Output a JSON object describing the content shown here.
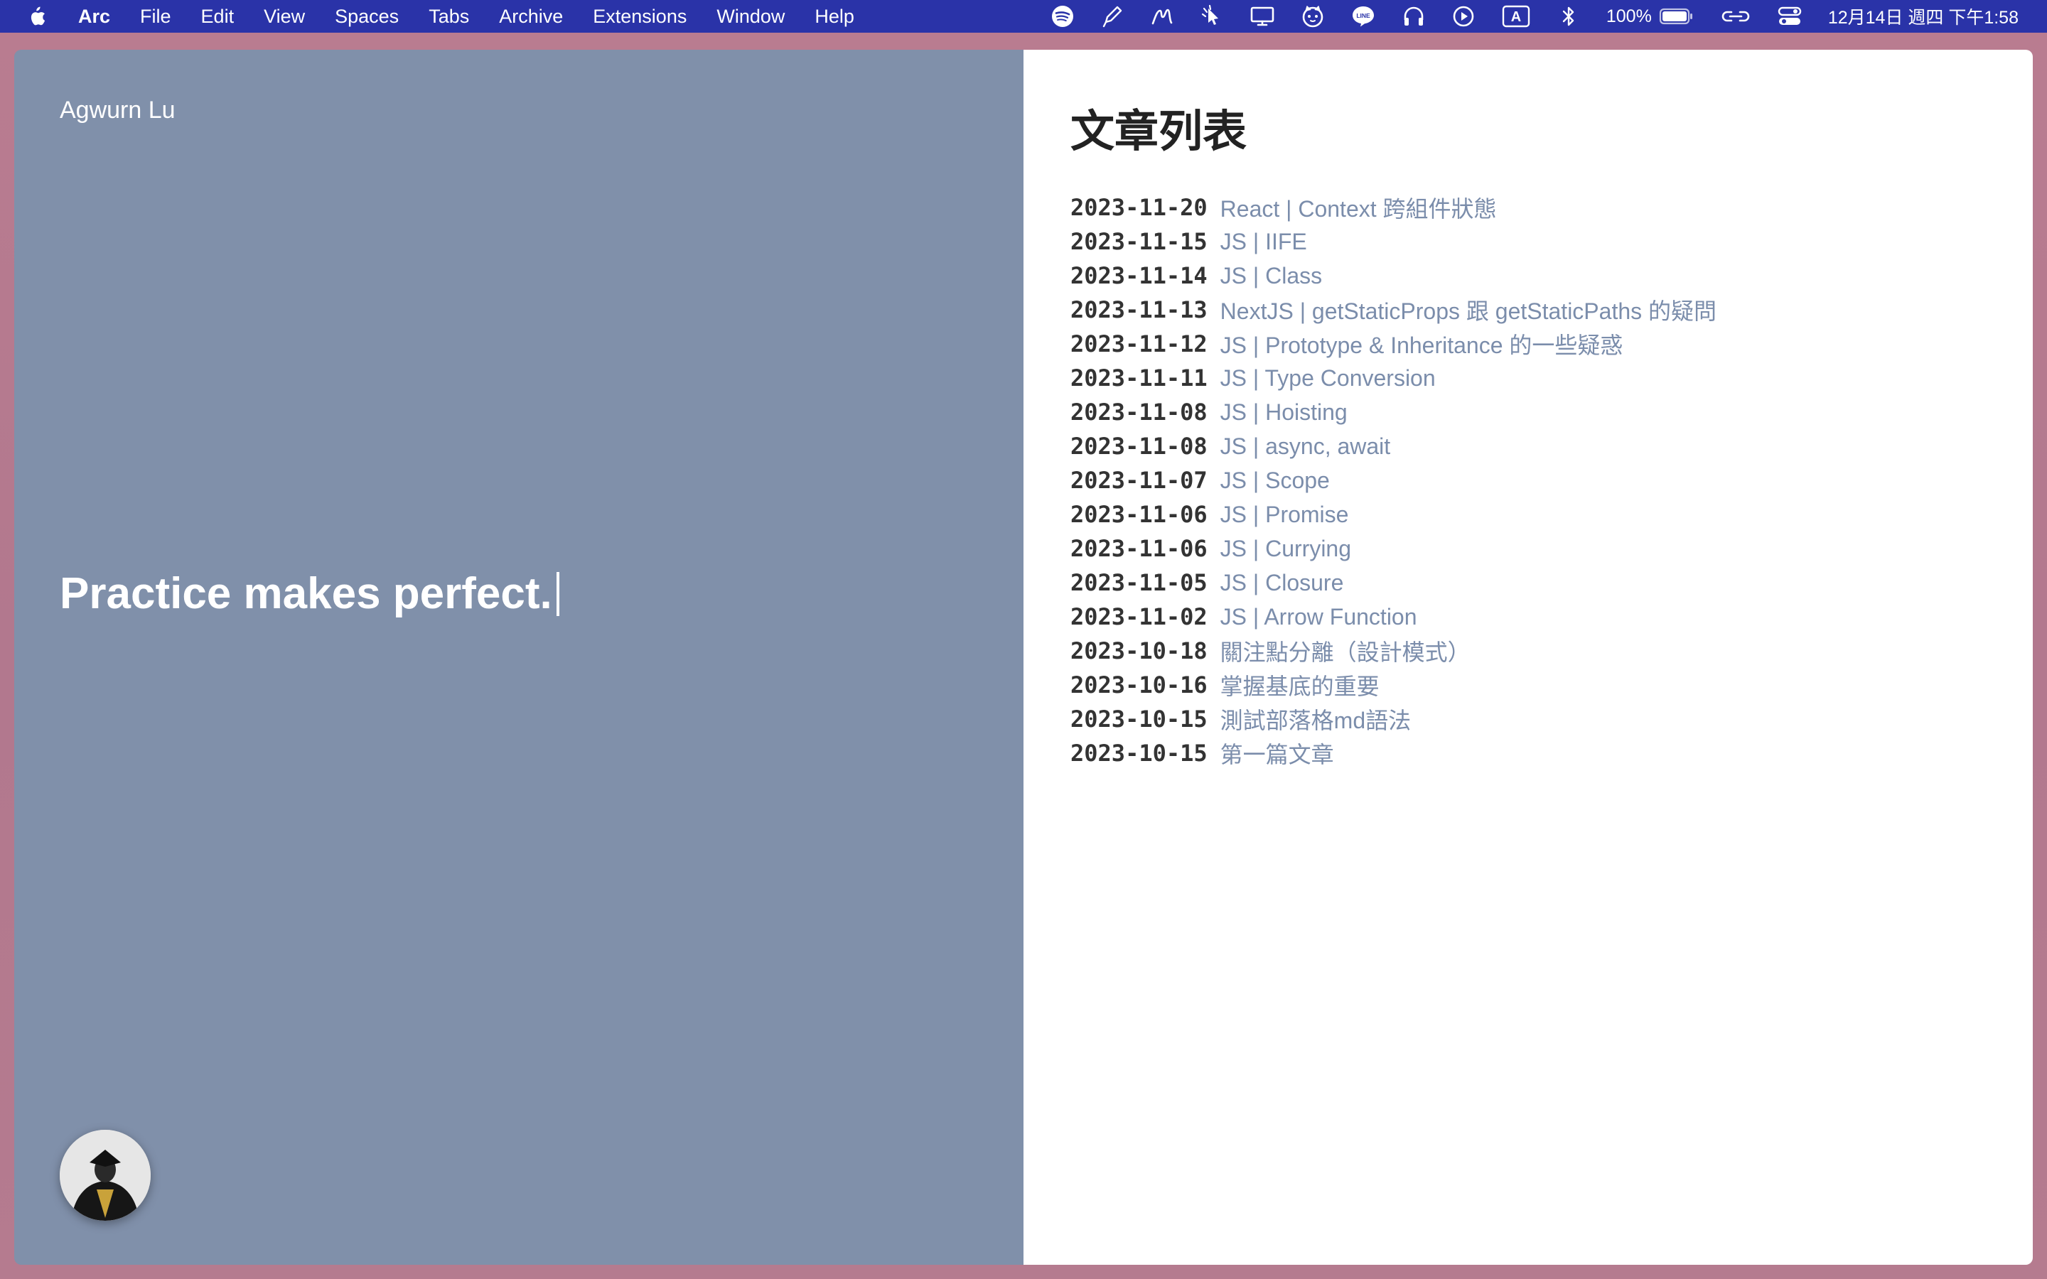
{
  "menubar": {
    "apple_icon": "apple-logo-icon",
    "app_name": "Arc",
    "menus": [
      "File",
      "Edit",
      "View",
      "Spaces",
      "Tabs",
      "Archive",
      "Extensions",
      "Window",
      "Help"
    ],
    "status_icons": [
      "spotify-icon",
      "pen-icon",
      "brush-icon",
      "cursor-gesture-icon",
      "display-icon",
      "cat-face-icon",
      "line-app-icon",
      "headphones-icon",
      "play-circle-icon",
      "input-source-icon",
      "bluetooth-icon"
    ],
    "input_source_label": "A",
    "battery_percent": "100%",
    "battery_level": 1.0,
    "datetime": "12月14日 週四 下午1:58"
  },
  "hero": {
    "site_name": "Agwurn Lu",
    "tagline": "Practice makes perfect.",
    "background_color": "#8090aa"
  },
  "content": {
    "title": "文章列表",
    "link_color": "#7b8dab",
    "posts": [
      {
        "date": "2023-11-20",
        "title": "React | Context 跨組件狀態"
      },
      {
        "date": "2023-11-15",
        "title": "JS | IIFE"
      },
      {
        "date": "2023-11-14",
        "title": "JS | Class"
      },
      {
        "date": "2023-11-13",
        "title": "NextJS | getStaticProps 跟 getStaticPaths 的疑問"
      },
      {
        "date": "2023-11-12",
        "title": "JS | Prototype & Inheritance 的一些疑惑"
      },
      {
        "date": "2023-11-11",
        "title": "JS | Type Conversion"
      },
      {
        "date": "2023-11-08",
        "title": "JS | Hoisting"
      },
      {
        "date": "2023-11-08",
        "title": "JS | async, await"
      },
      {
        "date": "2023-11-07",
        "title": "JS | Scope"
      },
      {
        "date": "2023-11-06",
        "title": "JS | Promise"
      },
      {
        "date": "2023-11-06",
        "title": "JS | Currying"
      },
      {
        "date": "2023-11-05",
        "title": "JS | Closure"
      },
      {
        "date": "2023-11-02",
        "title": "JS | Arrow Function"
      },
      {
        "date": "2023-10-18",
        "title": "關注點分離（設計模式）"
      },
      {
        "date": "2023-10-16",
        "title": "掌握基底的重要"
      },
      {
        "date": "2023-10-15",
        "title": "測試部落格md語法"
      },
      {
        "date": "2023-10-15",
        "title": "第一篇文章"
      }
    ]
  }
}
